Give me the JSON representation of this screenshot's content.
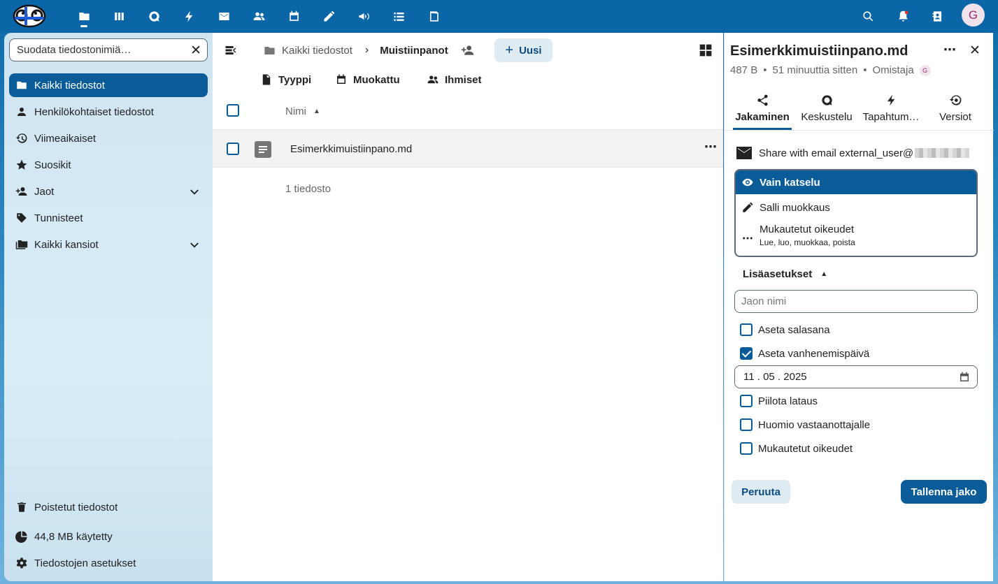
{
  "topbar": {
    "apps": [
      "files-icon",
      "dashboard-icon",
      "talk-icon",
      "activity-icon",
      "mail-icon",
      "contacts-icon",
      "calendar-icon",
      "notes-icon",
      "announcements-icon",
      "tasks-icon",
      "deck-icon"
    ],
    "right_icons": [
      "search-icon",
      "notifications-icon",
      "contacts-menu-icon"
    ],
    "avatar_letter": "G"
  },
  "sidebar": {
    "filter_placeholder": "Suodata tiedostonimiä…",
    "items": [
      {
        "label": "Kaikki tiedostot",
        "icon": "folder-icon",
        "active": true
      },
      {
        "label": "Henkilökohtaiset tiedostot",
        "icon": "person-icon"
      },
      {
        "label": "Viimeaikaiset",
        "icon": "history-icon"
      },
      {
        "label": "Suosikit",
        "icon": "star-icon"
      },
      {
        "label": "Jaot",
        "icon": "share-icon",
        "expandable": true
      },
      {
        "label": "Tunnisteet",
        "icon": "tag-icon"
      },
      {
        "label": "Kaikki kansiot",
        "icon": "folders-icon",
        "expandable": true
      }
    ],
    "footer": {
      "trash": "Poistetut tiedostot",
      "quota": "44,8 MB käytetty",
      "settings": "Tiedostojen asetukset"
    }
  },
  "main": {
    "breadcrumb": {
      "root": "Kaikki tiedostot",
      "current": "Muistiinpanot"
    },
    "new_button": "Uusi",
    "filters": {
      "type": "Tyyppi",
      "modified": "Muokattu",
      "people": "Ihmiset"
    },
    "column_name": "Nimi",
    "files": [
      {
        "name": "Esimerkkimuistiinpano.md"
      }
    ],
    "summary": "1 tiedosto"
  },
  "details": {
    "filename": "Esimerkkimuistiinpano.md",
    "size": "487 B",
    "modified": "51 minuuttia sitten",
    "owner_label": "Omistaja",
    "owner_avatar": "G",
    "tabs": [
      "Jakaminen",
      "Keskustelu",
      "Tapahtum…",
      "Versiot"
    ],
    "share_title": "Share with email external_user@",
    "permissions": [
      {
        "label": "Vain katselu",
        "icon": "eye-icon",
        "selected": true
      },
      {
        "label": "Salli muokkaus",
        "icon": "pencil-icon"
      },
      {
        "label": "Mukautetut oikeudet",
        "sub": "Lue, luo, muokkaa, poista",
        "icon": "dots-icon"
      }
    ],
    "advanced_label": "Lisäasetukset",
    "share_name_placeholder": "Jaon nimi",
    "options": [
      {
        "label": "Aseta salasana",
        "checked": false
      },
      {
        "label": "Aseta vanhenemispäivä",
        "checked": true
      }
    ],
    "expiry_date": "11 . 05 . 2025",
    "more_options": [
      {
        "label": "Piilota lataus",
        "checked": false
      },
      {
        "label": "Huomio vastaanottajalle",
        "checked": false
      },
      {
        "label": "Mukautetut oikeudet",
        "checked": false
      }
    ],
    "cancel_button": "Peruuta",
    "save_button": "Tallenna jako"
  }
}
